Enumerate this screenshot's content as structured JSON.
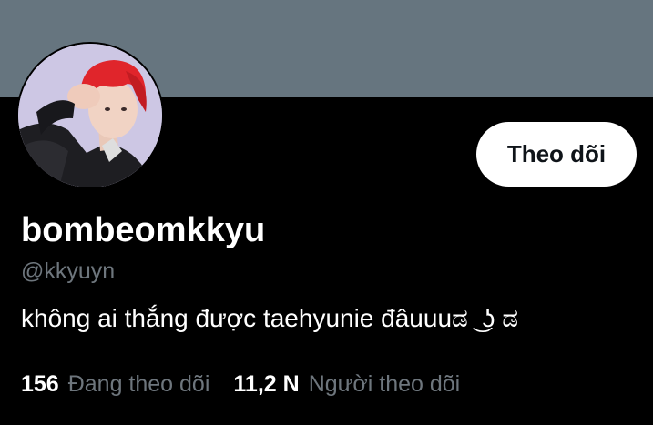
{
  "colors": {
    "banner": "#66757f",
    "background": "#000000",
    "primary_text": "#ffffff",
    "secondary_text": "#6e767d",
    "button_bg": "#ffffff",
    "button_text": "#0f1419"
  },
  "profile": {
    "display_name": "bombeomkkyu",
    "handle": "@kkyuyn",
    "bio": "không ai thắng được taehyunie đâuuuಡ ͜ ʖ ಡ",
    "avatar_icon": "profile-photo"
  },
  "actions": {
    "follow_label": "Theo dõi"
  },
  "stats": {
    "following_count": "156",
    "following_label": "Đang theo dõi",
    "followers_count": "11,2 N",
    "followers_label": "Người theo dõi"
  }
}
